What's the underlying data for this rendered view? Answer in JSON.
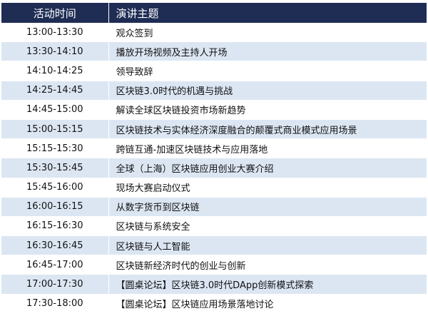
{
  "table": {
    "headers": [
      "活动时间",
      "演讲主题"
    ],
    "rows": [
      [
        "13:00-13:30",
        "观众签到"
      ],
      [
        "13:30-14:10",
        "播放开场视频及主持人开场"
      ],
      [
        "14:10-14:25",
        "领导致辞"
      ],
      [
        "14:25-14:45",
        "区块链3.0时代的机遇与挑战"
      ],
      [
        "14:45-15:00",
        "解读全球区块链投资市场新趋势"
      ],
      [
        "15:00-15:15",
        "区块链技术与实体经济深度融合的颠覆式商业模式应用场景"
      ],
      [
        "15:15-15:30",
        "跨链互通-加速区块链技术与应用落地"
      ],
      [
        "15:30-15:45",
        "全球（上海）区块链应用创业大赛介绍"
      ],
      [
        "15:45-16:00",
        "现场大赛启动仪式"
      ],
      [
        "16:00-16:15",
        "从数字货币到区块链"
      ],
      [
        "16:15-16:30",
        "区块链与系统安全"
      ],
      [
        "16:30-16:45",
        "区块链与人工智能"
      ],
      [
        "16:45-17:00",
        "区块链新经济时代的创业与创新"
      ],
      [
        "17:00-17:30",
        "【圆桌论坛】区块链3.0时代DApp创新模式探索"
      ],
      [
        "17:30-18:00",
        "【圆桌论坛】区块链应用场景落地讨论"
      ]
    ]
  },
  "colors": {
    "header_bg": "#1f2d55",
    "header_text": "#ffffff",
    "row_alt_bg": "#dce6f3",
    "row_bg": "#ffffff"
  }
}
